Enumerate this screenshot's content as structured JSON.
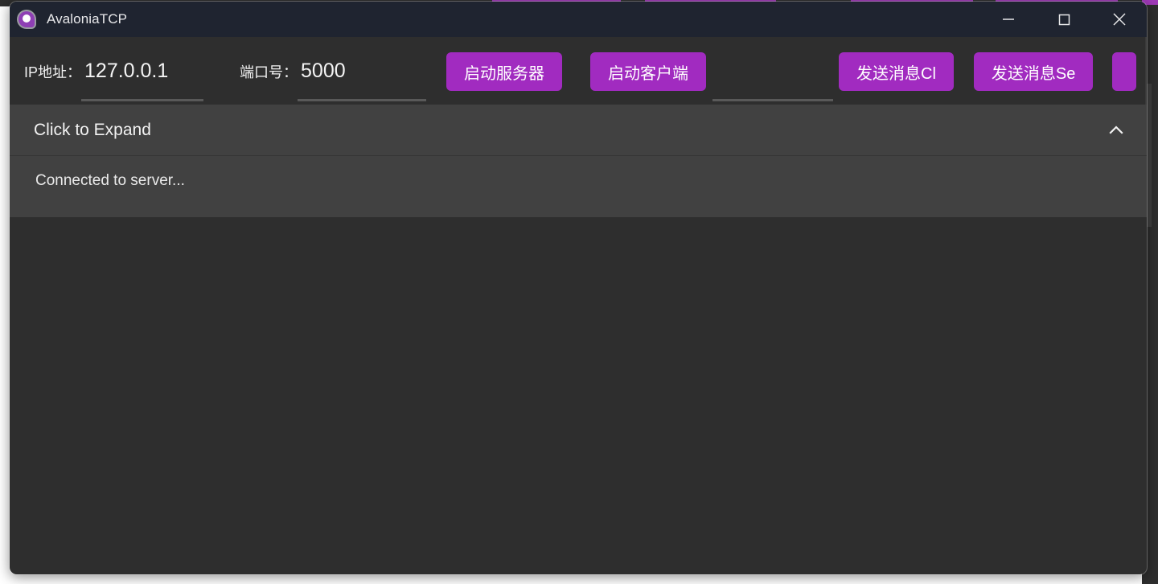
{
  "window": {
    "title": "AvaloniaTCP",
    "icon": "avalonia-logo-icon",
    "controls": {
      "minimize": "minimize-icon",
      "maximize": "maximize-icon",
      "close": "close-icon"
    }
  },
  "toolbar": {
    "ip_label": "IP地址：",
    "ip_value": "127.0.0.1",
    "port_label": "端口号：",
    "port_value": "5000",
    "start_server_button": "启动服务器",
    "start_client_button": "启动客户端",
    "send_message_client_button": "发送消息Cl",
    "send_message_server_button": "发送消息Se",
    "overflow_button": ""
  },
  "expander": {
    "header_title": "Click to Expand",
    "chevron": "chevron-up-icon",
    "message": "Connected to server..."
  },
  "colors": {
    "accent_purple": "#a12bc0",
    "titlebar_bg": "#1f2430",
    "window_bg": "#2e2e2e",
    "expander_bg": "#414141",
    "text_primary": "#f2f2f2"
  }
}
